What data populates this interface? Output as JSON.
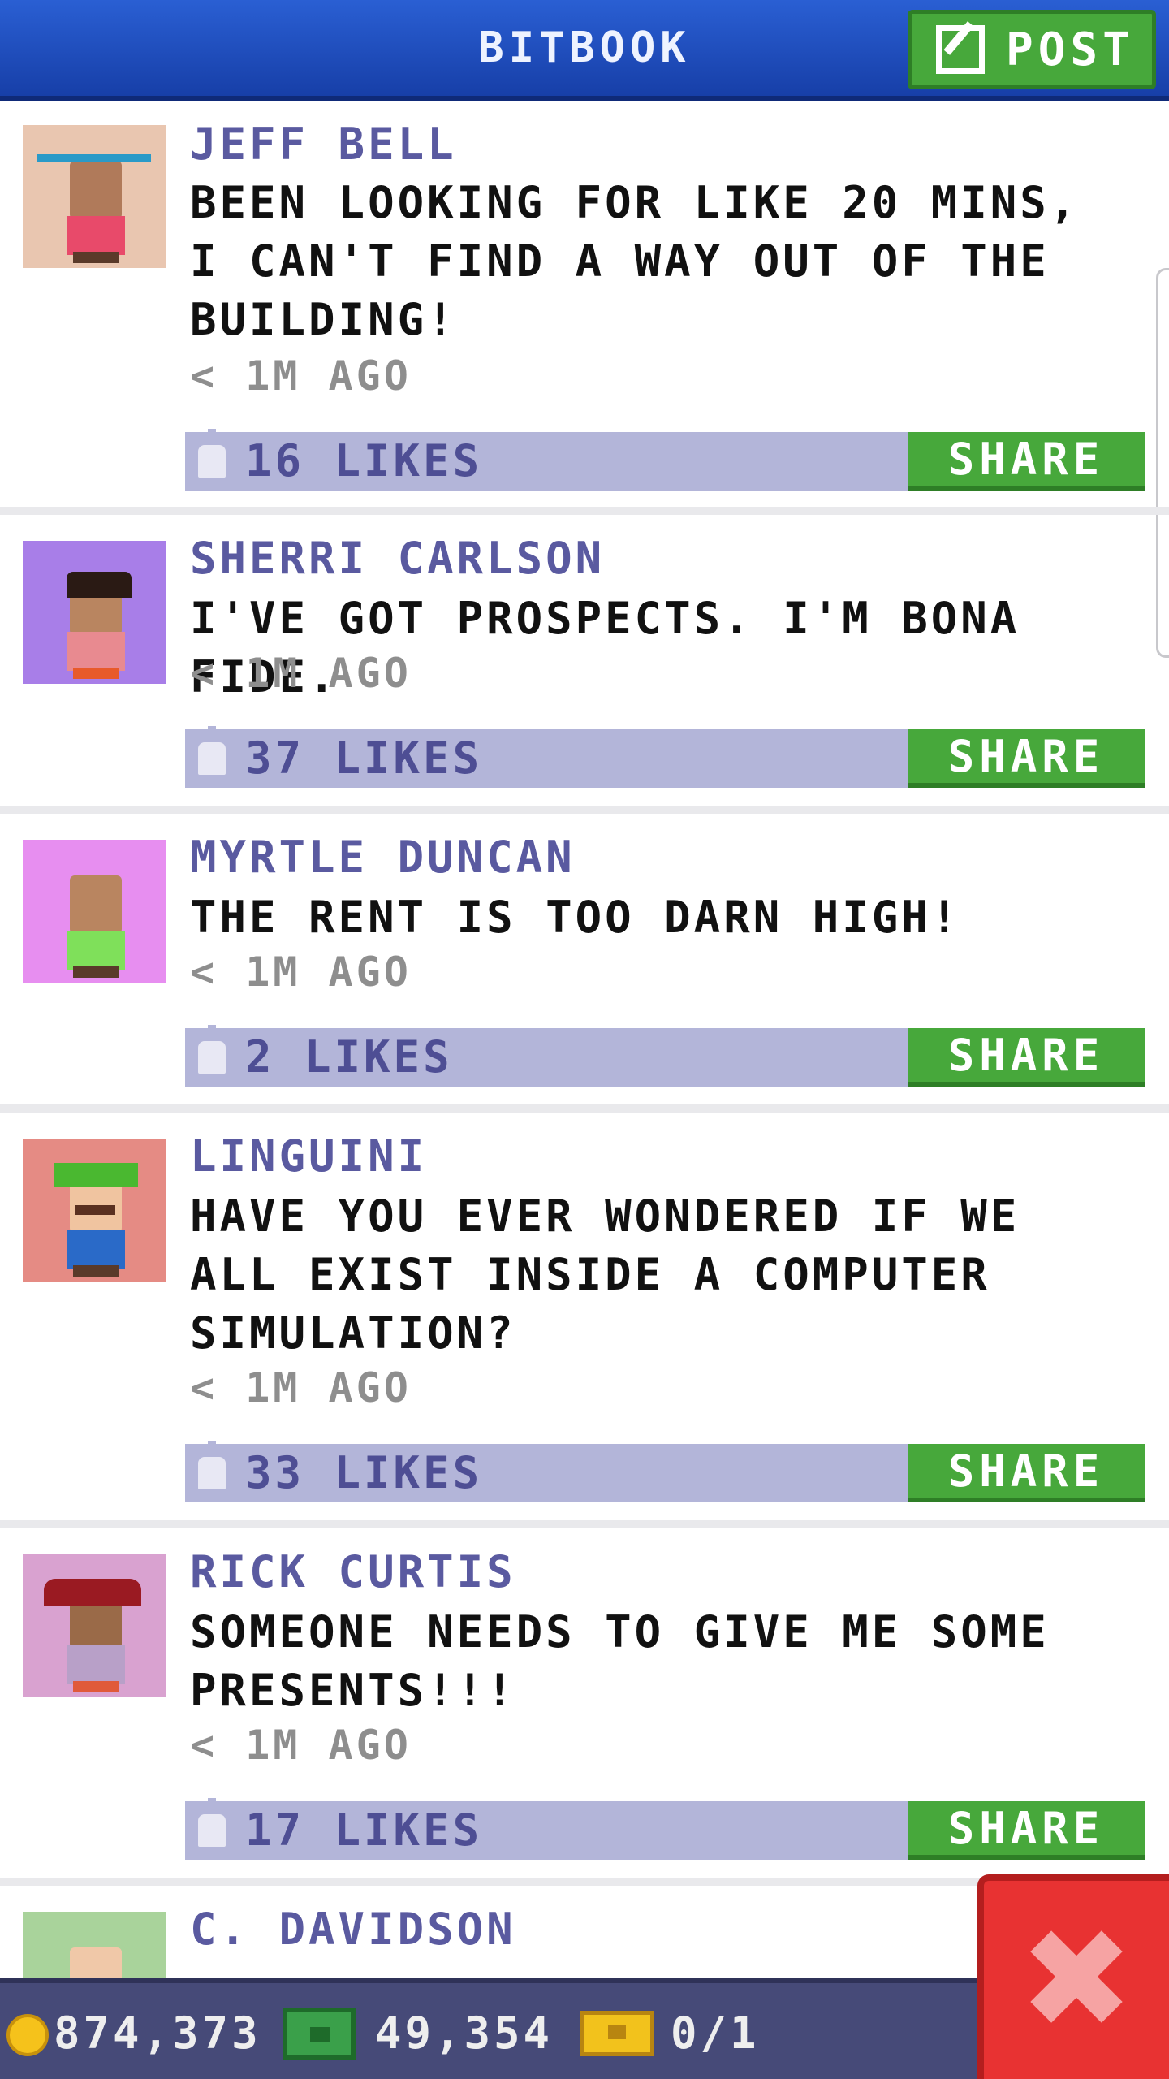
{
  "header": {
    "title": "BITBOOK",
    "post_label": "POST"
  },
  "posts": [
    {
      "name": "JEFF BELL",
      "message": "BEEN LOOKING FOR LIKE 20 MINS, I CAN'T FIND A WAY OUT OF THE BUILDING!",
      "time": "< 1M AGO",
      "likes": "16 LIKES",
      "share_label": "SHARE",
      "avatar_bg": "#e9c6b0"
    },
    {
      "name": "SHERRI CARLSON",
      "message": "I'VE GOT PROSPECTS. I'M BONA FIDE.",
      "time": "< 1M AGO",
      "likes": "37 LIKES",
      "share_label": "SHARE",
      "avatar_bg": "#a87ee8"
    },
    {
      "name": "MYRTLE DUNCAN",
      "message": "THE RENT IS TOO DARN HIGH!",
      "time": "< 1M AGO",
      "likes": "2 LIKES",
      "share_label": "SHARE",
      "avatar_bg": "#e78ef0"
    },
    {
      "name": "LINGUINI",
      "message": "HAVE YOU EVER WONDERED IF WE ALL EXIST INSIDE A COMPUTER SIMULATION?",
      "time": "< 1M AGO",
      "likes": "33 LIKES",
      "share_label": "SHARE",
      "avatar_bg": "#e58b84"
    },
    {
      "name": "RICK CURTIS",
      "message": "SOMEONE NEEDS TO GIVE ME SOME PRESENTS!!!",
      "time": "< 1M AGO",
      "likes": "17 LIKES",
      "share_label": "SHARE",
      "avatar_bg": "#d9a2d0"
    },
    {
      "name": "C. DAVIDSON",
      "avatar_bg": "#a9d39b"
    }
  ],
  "status": {
    "coins": "874,373",
    "bux": "49,354",
    "tickets": "0/1"
  },
  "colors": {
    "header_blue": "#2a5fd3",
    "share_green": "#47a83b",
    "likes_bar": "#b3b5d9",
    "name_purple": "#5a5aa0",
    "close_red": "#e83232"
  },
  "icons": {
    "post": "edit-icon",
    "like": "thumbs-up-icon",
    "coin": "coin-icon",
    "bux": "bux-icon",
    "ticket": "ticket-icon",
    "close": "close-icon"
  }
}
